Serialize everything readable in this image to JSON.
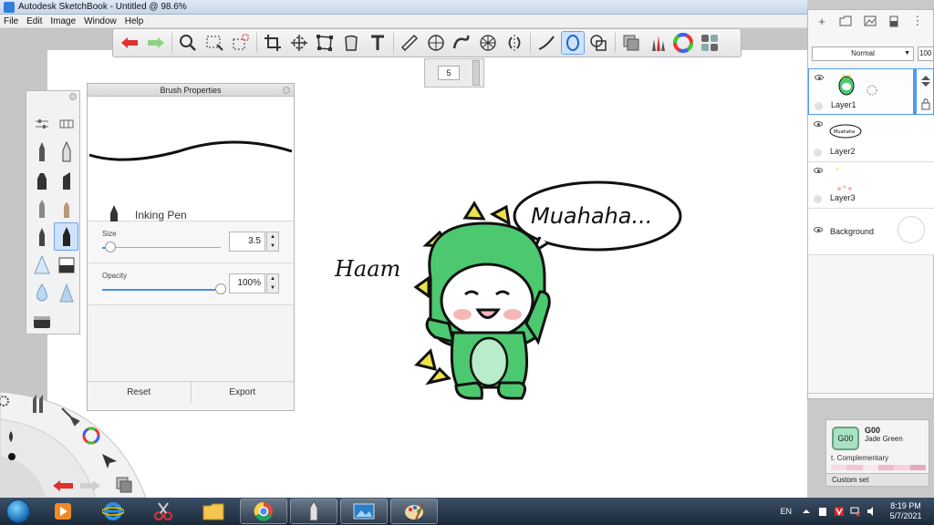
{
  "window": {
    "title": "Autodesk SketchBook - Untitled @ 98.6%"
  },
  "menu": [
    "File",
    "Edit",
    "Image",
    "Window",
    "Help"
  ],
  "brush_size_indicator": "5",
  "brush_properties": {
    "header": "Brush Properties",
    "brush_name": "Inking Pen",
    "size_label": "Size",
    "size_value": "3.5",
    "size_fraction": 0.07,
    "opacity_label": "Opacity",
    "opacity_value": "100%",
    "opacity_fraction": 1.0,
    "reset_label": "Reset",
    "export_label": "Export"
  },
  "layers": {
    "blend_mode": "Normal",
    "opacity": "100",
    "items": [
      {
        "name": "Layer1",
        "selected": true
      },
      {
        "name": "Layer2",
        "selected": false
      },
      {
        "name": "Layer3",
        "selected": false
      },
      {
        "name": "Background",
        "selected": false
      }
    ],
    "layer2_thumb_text": "Muahaha"
  },
  "copic": {
    "swatch_code": "G00",
    "code": "G00",
    "name": "Jade Green",
    "complementary": "t. Complementary",
    "custom_set": "Custom set",
    "swatch_color": "#a8e2c3"
  },
  "canvas": {
    "speech_bubble_text": "Muahaha...",
    "signature_text": "Haam"
  },
  "taskbar": {
    "language": "EN",
    "time": "8:19 PM",
    "date": "5/7/2021"
  },
  "colors": {
    "dino_green": "#4cc96f",
    "dino_belly": "#b9ecc9",
    "dino_spikes": "#ece24a",
    "blush": "#f6b7b7",
    "accent_blue": "#4d8fe0"
  }
}
